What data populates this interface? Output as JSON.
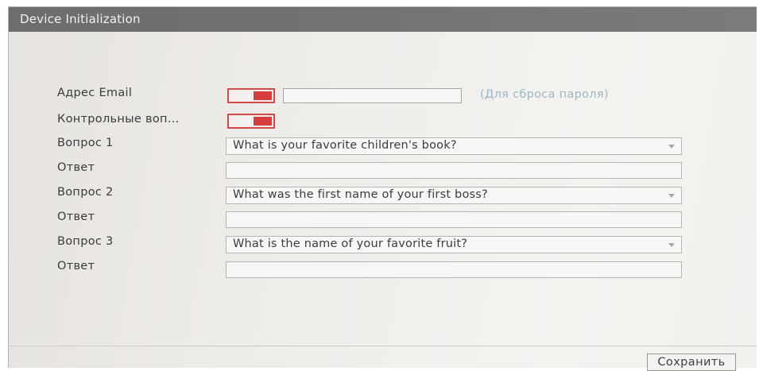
{
  "window": {
    "title": "Device Initialization"
  },
  "form": {
    "email": {
      "label": "Адрес Email",
      "toggle_on": true,
      "value": "",
      "hint": "(Для сброса пароля)"
    },
    "security_questions": {
      "label": "Контрольные воп...",
      "toggle_on": true
    },
    "questions": [
      {
        "label": "Вопрос 1",
        "selected": "What is your favorite children's book?",
        "answer_label": "Ответ",
        "answer": ""
      },
      {
        "label": "Вопрос 2",
        "selected": "What was the first name of your first boss?",
        "answer_label": "Ответ",
        "answer": ""
      },
      {
        "label": "Вопрос 3",
        "selected": "What is the name of your favorite fruit?",
        "answer_label": "Ответ",
        "answer": ""
      }
    ]
  },
  "footer": {
    "save_label": "Сохранить"
  },
  "colors": {
    "accent": "#d83c3c",
    "titlebar": "#727172",
    "hint": "#9cb7c4"
  },
  "icons": {
    "dropdown": "chevron-down-icon"
  }
}
